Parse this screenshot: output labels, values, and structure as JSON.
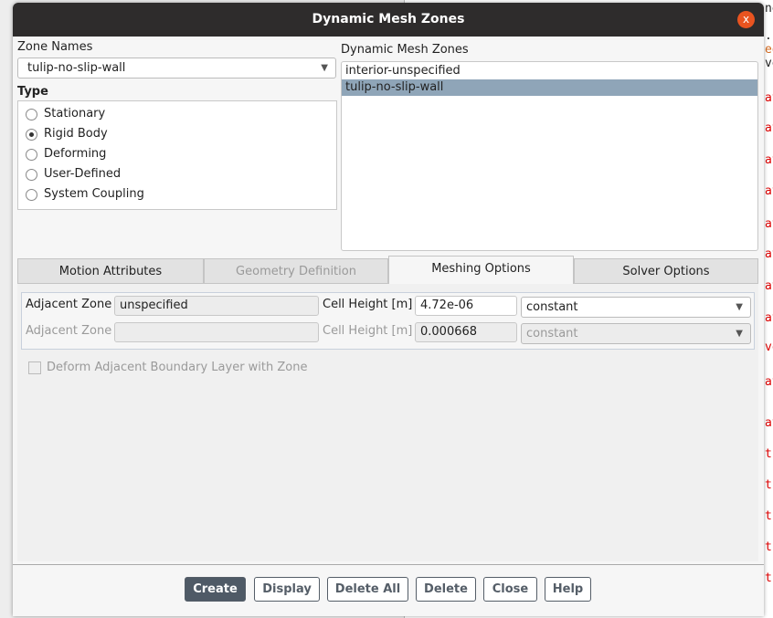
{
  "window": {
    "title": "Dynamic Mesh Zones",
    "close_glyph": "x"
  },
  "zone_names": {
    "label": "Zone Names",
    "value": "tulip-no-slip-wall"
  },
  "type": {
    "label": "Type",
    "options": [
      "Stationary",
      "Rigid Body",
      "Deforming",
      "User-Defined",
      "System Coupling"
    ],
    "selected": "Rigid Body"
  },
  "dynamic_zones": {
    "label": "Dynamic Mesh Zones",
    "items": [
      "interior-unspecified",
      "tulip-no-slip-wall"
    ],
    "selected": "tulip-no-slip-wall"
  },
  "tabs": [
    {
      "label": "Motion Attributes",
      "state": "normal"
    },
    {
      "label": "Geometry Definition",
      "state": "disabled"
    },
    {
      "label": "Meshing Options",
      "state": "active"
    },
    {
      "label": "Solver Options",
      "state": "normal"
    }
  ],
  "meshing": {
    "row1": {
      "adj_label": "Adjacent Zone",
      "adj_value": "unspecified",
      "cell_label": "Cell Height [m]",
      "cell_value": "4.72e-06",
      "method": "constant"
    },
    "row2": {
      "adj_label": "Adjacent Zone",
      "adj_value": "",
      "cell_label": "Cell Height [m]",
      "cell_value": "0.000668",
      "method": "constant"
    },
    "deform_checkbox": {
      "label": "Deform Adjacent Boundary Layer with Zone",
      "checked": false
    }
  },
  "buttons": [
    "Create",
    "Display",
    "Delete All",
    "Delete",
    "Close",
    "Help"
  ],
  "console_fragments": [
    {
      "t": "ne",
      "c": "#222"
    },
    {
      "t": "..",
      "c": "#222"
    },
    {
      "t": "ed",
      "c": "#d2691e"
    },
    {
      "t": "ve",
      "c": "#222"
    },
    {
      "t": "at",
      "c": "#d00"
    },
    {
      "t": "at",
      "c": "#d00"
    },
    {
      "t": "at",
      "c": "#d00"
    },
    {
      "t": "at",
      "c": "#d00"
    },
    {
      "t": "at",
      "c": "#d00"
    },
    {
      "t": "at",
      "c": "#d00"
    },
    {
      "t": "at",
      "c": "#d00"
    },
    {
      "t": "at",
      "c": "#d00"
    },
    {
      "t": "vo",
      "c": "#d00"
    },
    {
      "t": "at",
      "c": "#d00"
    },
    {
      "t": "at",
      "c": "#d00"
    },
    {
      "t": "ti",
      "c": "#d00"
    },
    {
      "t": "ti",
      "c": "#d00"
    },
    {
      "t": "ti",
      "c": "#d00"
    },
    {
      "t": "ti",
      "c": "#d00"
    },
    {
      "t": "ti",
      "c": "#d00"
    }
  ],
  "colors": {
    "titlebar": "#2e2c2c",
    "close": "#e95420",
    "selection": "#8fa5b8",
    "primary_button": "#4f5a66"
  }
}
